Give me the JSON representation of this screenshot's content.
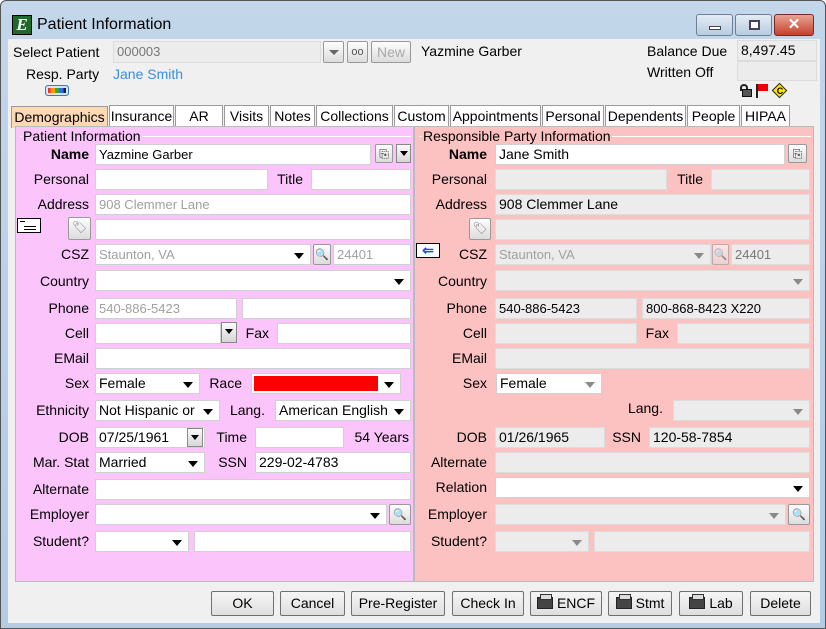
{
  "window": {
    "title": "Patient Information",
    "app_icon_letter": "E",
    "controls": {
      "minimize": "minimize",
      "maximize": "maximize",
      "close": "close"
    }
  },
  "header": {
    "select_patient_label": "Select Patient",
    "patient_id": "000003",
    "new_button": "New",
    "patient_name": "Yazmine Garber",
    "resp_party_label": "Resp. Party",
    "resp_party_name": "Jane Smith",
    "balance_due_label": "Balance Due",
    "balance_due": "8,497.45",
    "written_off_label": "Written Off",
    "written_off": "",
    "status_icons": [
      "lock-open-icon",
      "red-flag-icon",
      "collections-c-icon"
    ],
    "status_icon_c": "C"
  },
  "tabs": [
    {
      "label": "Demographics",
      "active": true
    },
    {
      "label": "Insurance"
    },
    {
      "label": "AR"
    },
    {
      "label": "Visits"
    },
    {
      "label": "Notes"
    },
    {
      "label": "Collections"
    },
    {
      "label": "Custom"
    },
    {
      "label": "Appointments"
    },
    {
      "label": "Personal"
    },
    {
      "label": "Dependents"
    },
    {
      "label": "People"
    },
    {
      "label": "HIPAA"
    }
  ],
  "patient": {
    "group_title": "Patient Information",
    "labels": {
      "name": "Name",
      "personal": "Personal",
      "title": "Title",
      "address": "Address",
      "csz": "CSZ",
      "country": "Country",
      "phone": "Phone",
      "cell": "Cell",
      "fax": "Fax",
      "email": "EMail",
      "sex": "Sex",
      "race": "Race",
      "ethnicity": "Ethnicity",
      "lang": "Lang.",
      "dob": "DOB",
      "time": "Time",
      "mar_stat": "Mar. Stat",
      "ssn": "SSN",
      "alternate": "Alternate",
      "employer": "Employer",
      "student": "Student?"
    },
    "values": {
      "name": "Yazmine Garber",
      "personal": "",
      "title": "",
      "address1": "908 Clemmer Lane",
      "address2": "",
      "csz": "Staunton, VA",
      "zip": "24401",
      "country": "",
      "phone1": "540-886-5423",
      "phone2": "",
      "cell": "",
      "fax": "",
      "email": "",
      "sex": "Female",
      "race": "",
      "race_color": "#ff0000",
      "ethnicity": "Not Hispanic or",
      "lang": "American English",
      "dob": "07/25/1961",
      "time": "",
      "age": "54 Years",
      "mar_stat": "Married",
      "ssn": "229-02-4783",
      "alternate": "",
      "employer": "",
      "student": "",
      "student_extra": ""
    }
  },
  "resp_party": {
    "group_title": "Responsible Party Information",
    "labels": {
      "name": "Name",
      "personal": "Personal",
      "title": "Title",
      "address": "Address",
      "csz": "CSZ",
      "country": "Country",
      "phone": "Phone",
      "cell": "Cell",
      "fax": "Fax",
      "email": "EMail",
      "sex": "Sex",
      "lang": "Lang.",
      "dob": "DOB",
      "ssn": "SSN",
      "alternate": "Alternate",
      "relation": "Relation",
      "employer": "Employer",
      "student": "Student?"
    },
    "values": {
      "name": "Jane Smith",
      "personal": "",
      "title": "",
      "address1": "908 Clemmer Lane",
      "address2": "",
      "csz": "Staunton, VA",
      "zip": "24401",
      "country": "",
      "phone1": "540-886-5423",
      "phone2": "800-868-8423 X220",
      "cell": "",
      "fax": "",
      "email": "",
      "sex": "Female",
      "lang": "",
      "dob": "01/26/1965",
      "ssn": "120-58-7854",
      "alternate": "",
      "relation": "",
      "employer": "",
      "student": "",
      "student_extra": ""
    }
  },
  "footer": {
    "ok": "OK",
    "cancel": "Cancel",
    "pre_register": "Pre-Register",
    "check_in": "Check In",
    "encf": "ENCF",
    "stmt": "Stmt",
    "lab": "Lab",
    "delete": "Delete"
  }
}
